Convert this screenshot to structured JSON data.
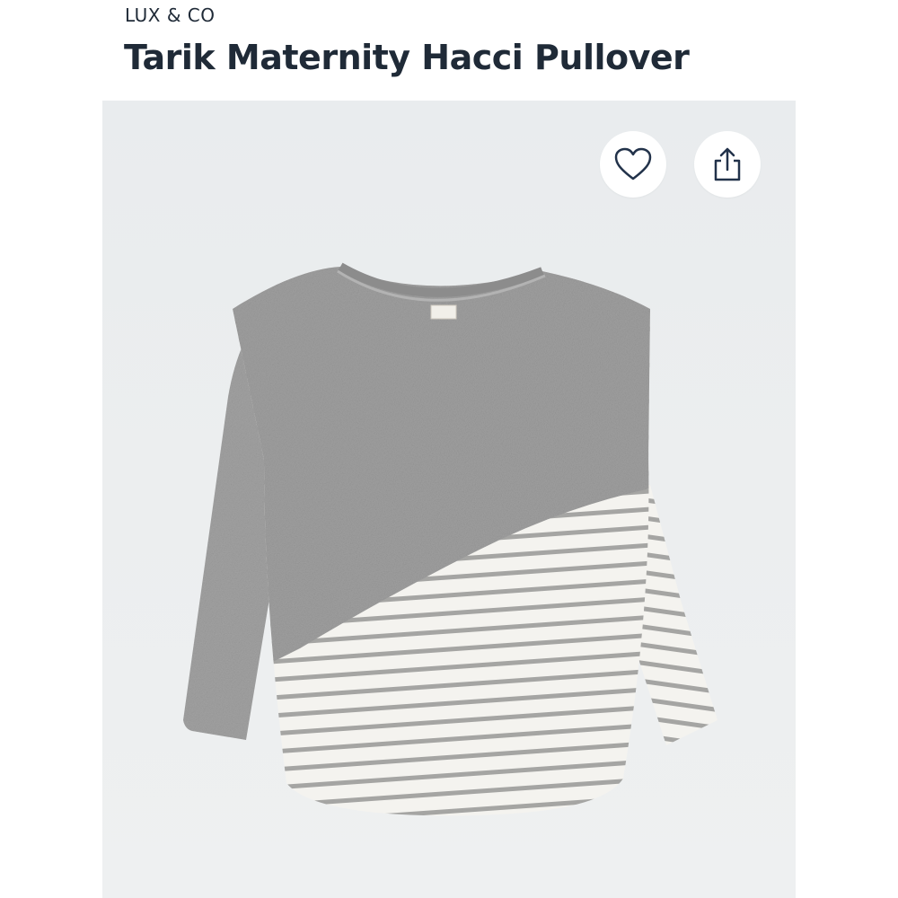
{
  "product": {
    "brand": "LUX & CO",
    "title": "Tarik Maternity Hacci Pullover"
  },
  "actions": {
    "favorite_icon": "heart-outline-icon",
    "share_icon": "share-upload-icon"
  },
  "colors": {
    "text": "#1f2a37",
    "icon_stroke": "#22324a",
    "heather_gray": "#9d9d9d",
    "stripe_white": "#f4f3ef",
    "stripe_gray": "#a5a5a3",
    "photo_bg": "#eceeef"
  }
}
